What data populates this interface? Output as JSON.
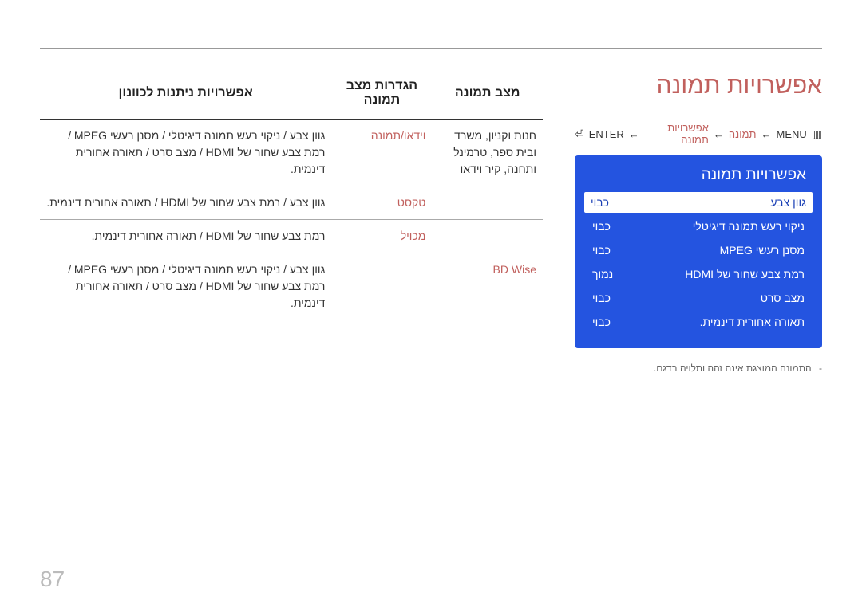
{
  "section_title": "אפשרויות תמונה",
  "breadcrumb": {
    "menu_label": "MENU",
    "item1": "תמונה",
    "item2": "אפשרויות תמונה",
    "enter_label": "ENTER"
  },
  "menu_panel": {
    "title": "אפשרויות תמונה",
    "rows": [
      {
        "label": "גוון צבע",
        "value": "כבוי",
        "highlight": true
      },
      {
        "label": "ניקוי רעש תמונה דיגיטלי",
        "value": "כבוי",
        "highlight": false
      },
      {
        "label": "מסנן רעשי MPEG",
        "value": "כבוי",
        "highlight": false
      },
      {
        "label": "רמת צבע שחור של HDMI",
        "value": "נמוך",
        "highlight": false
      },
      {
        "label": "מצב סרט",
        "value": "כבוי",
        "highlight": false
      },
      {
        "label": "תאורה אחורית דינמית.",
        "value": "כבוי",
        "highlight": false
      }
    ]
  },
  "footnote": "התמונה המוצגת אינה זהה ותלויה בדגם.",
  "table": {
    "headers": {
      "c1": "מצב תמונה",
      "c2": "הגדרות מצב תמונה",
      "c3": "אפשרויות ניתנות לכוונון"
    },
    "rows": [
      {
        "c1": "חנות וקניון, משרד ובית ספר, טרמינל ותחנה, קיר וידאו",
        "c2": "וידאו/תמונה",
        "c3": "גוון צבע / ניקוי רעש תמונה דיגיטלי / מסנן רעשי MPEG / רמת צבע שחור של HDMI / מצב סרט / תאורה אחורית דינמית."
      },
      {
        "c1": "",
        "c2": "טקסט",
        "c3": "גוון צבע / רמת צבע שחור של HDMI / תאורה אחורית דינמית."
      },
      {
        "c1": "",
        "c2": "מכויל",
        "c3": "רמת צבע שחור של HDMI / תאורה אחורית דינמית."
      },
      {
        "c1": "BD Wise",
        "c2": "",
        "c3": "גוון צבע / ניקוי רעש תמונה דיגיטלי / מסנן רעשי MPEG / רמת צבע שחור של HDMI / מצב סרט / תאורה אחורית דינמית."
      }
    ]
  },
  "page_number": "87"
}
